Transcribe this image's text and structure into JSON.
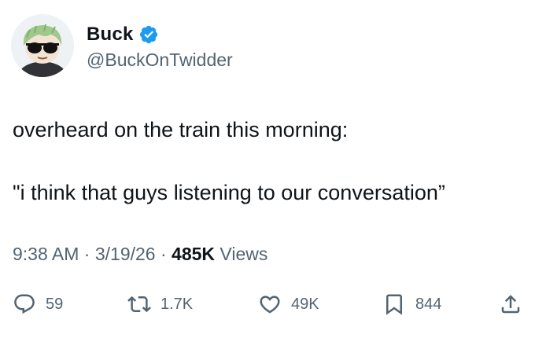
{
  "user": {
    "display_name": "Buck",
    "handle": "@BuckOnTwidder",
    "verified": true,
    "avatar_icon": "avatar-cartoon-sunglasses",
    "verified_color": "#1d9bf0"
  },
  "tweet": {
    "line1": "overheard on the train this morning:",
    "line2": "\"i think that guys listening to our conversation”"
  },
  "meta": {
    "time": "9:38 AM",
    "separator": "·",
    "date": "3/19/26",
    "views_count": "485K",
    "views_label": "Views"
  },
  "actions": {
    "replies": "59",
    "retweets": "1.7K",
    "likes": "49K",
    "bookmarks": "844"
  },
  "colors": {
    "text": "#0f1419",
    "secondary": "#536471",
    "accent": "#1d9bf0"
  }
}
